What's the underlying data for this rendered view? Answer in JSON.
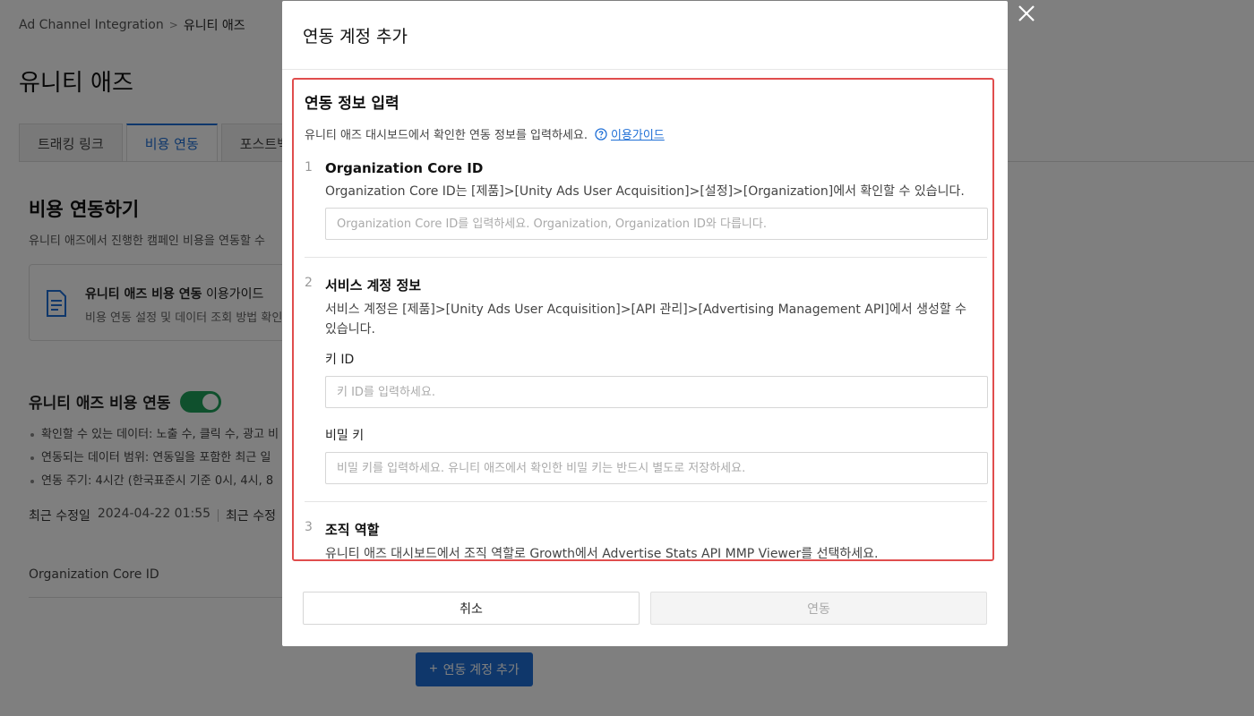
{
  "breadcrumb": {
    "parent": "Ad Channel Integration",
    "separator": ">",
    "current": "유니티 애즈"
  },
  "page": {
    "title": "유니티 애즈",
    "tabs": [
      {
        "label": "트래킹 링크"
      },
      {
        "label": "비용 연동"
      },
      {
        "label": "포스트백"
      }
    ],
    "section_title": "비용 연동하기",
    "section_desc": "유니티 애즈에서 진행한 캠페인 비용을 연동할 수",
    "guide_card": {
      "title_bold": "유니티 애즈 비용 연동",
      "title_rest": " 이용가이드",
      "desc": "비용 연동 설정 및 데이터 조회 방법 확인"
    },
    "toggle_label": "유니티 애즈 비용 연동",
    "bullets": [
      "확인할 수 있는 데이터: 노출 수, 클릭 수, 광고 비",
      "연동되는 데이터 범위: 연동일을 포함한 최근 일",
      "연동 주기: 4시간 (한국표준시 기준 0시, 4시, 8"
    ],
    "modified_label": "최근 수정일",
    "modified_value": "2024-04-22 01:55",
    "modified_label2": "최근 수정",
    "org_core_label": "Organization Core ID",
    "add_account_label": "연동 계정 추가",
    "add_account_plus": "+"
  },
  "modal": {
    "title": "연동 계정 추가",
    "info_title": "연동 정보 입력",
    "info_desc": "유니티 애즈 대시보드에서 확인한 연동 정보를 입력하세요.",
    "guide_link": "이용가이드",
    "steps": [
      {
        "num": "1",
        "title": "Organization Core ID",
        "desc": "Organization Core ID는 [제품]>[Unity Ads User Acquisition]>[설정]>[Organization]에서 확인할 수 있습니다.",
        "placeholder": "Organization Core ID를 입력하세요. Organization, Organization ID와 다릅니다."
      },
      {
        "num": "2",
        "title": "서비스 계정 정보",
        "desc_line1": "서비스 계정은 [제품]>[Unity Ads User Acquisition]>[API 관리]>[Advertising Management API]에서 생성할 수",
        "desc_line2": "있습니다.",
        "key_id_label": "키 ID",
        "key_id_placeholder": "키 ID를 입력하세요.",
        "secret_label": "비밀 키",
        "secret_placeholder": "비밀 키를 입력하세요. 유니티 애즈에서 확인한 비밀 키는 반드시 별도로 저장하세요."
      },
      {
        "num": "3",
        "title": "조직 역할",
        "desc": "유니티 애즈 대시보드에서 조직 역할로 Growth에서 Advertise Stats API MMP Viewer를 선택하세요."
      }
    ],
    "cancel_label": "취소",
    "confirm_label": "연동"
  },
  "colors": {
    "accent": "#1f6fd6",
    "highlight_border": "#e04d4d",
    "toggle_on": "#1fa15a"
  }
}
